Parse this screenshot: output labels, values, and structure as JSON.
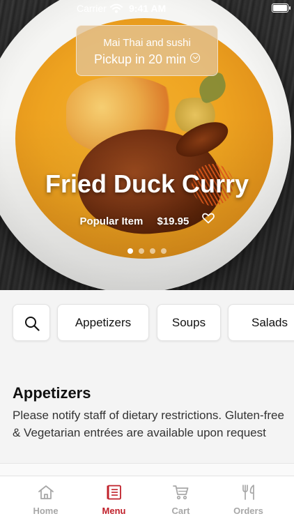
{
  "status_bar": {
    "carrier": "Carrier",
    "time": "9:41 AM"
  },
  "pickup": {
    "restaurant": "Mai Thai and sushi",
    "pickup_text": "Pickup in 20 min"
  },
  "featured": {
    "title": "Fried Duck Curry",
    "badge": "Popular Item",
    "price": "$19.95",
    "carousel": {
      "count": 4,
      "active_index": 0
    }
  },
  "categories": [
    "Appetizers",
    "Soups",
    "Salads"
  ],
  "section": {
    "title": "Appetizers",
    "description": "Please notify staff of dietary restrictions. Gluten-free & Vegetarian entrées are available upon request"
  },
  "tabs": [
    {
      "label": "Home",
      "icon": "home-icon",
      "active": false
    },
    {
      "label": "Menu",
      "icon": "menu-icon",
      "active": true
    },
    {
      "label": "Cart",
      "icon": "cart-icon",
      "active": false
    },
    {
      "label": "Orders",
      "icon": "fork-knife-icon",
      "active": false
    }
  ],
  "colors": {
    "accent": "#c0202a",
    "inactive_tab": "#a7a7a7"
  }
}
